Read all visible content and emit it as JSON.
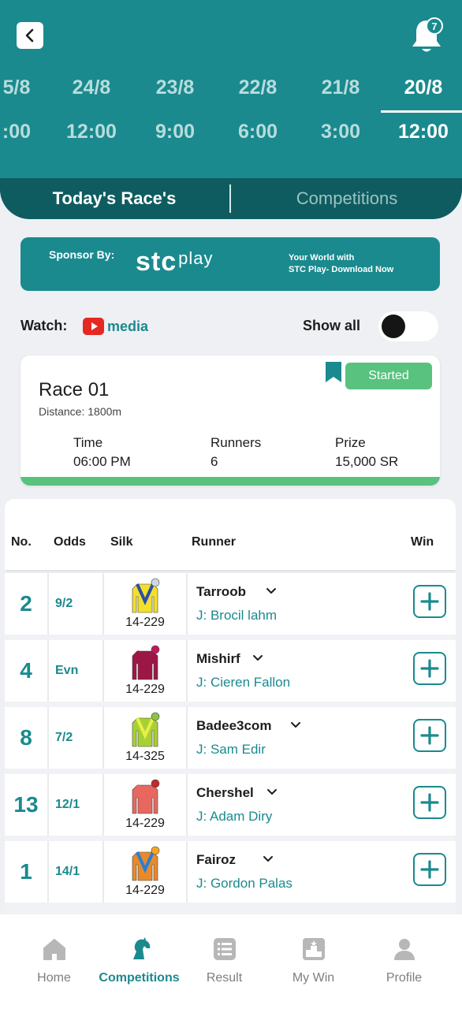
{
  "header": {
    "notification_count": "7",
    "dates": [
      {
        "date": "5/8",
        "time": ":00"
      },
      {
        "date": "24/8",
        "time": "12:00"
      },
      {
        "date": "23/8",
        "time": "9:00"
      },
      {
        "date": "22/8",
        "time": "6:00"
      },
      {
        "date": "21/8",
        "time": "3:00"
      },
      {
        "date": "20/8",
        "time": "12:00",
        "active": true
      }
    ],
    "tabs": [
      {
        "label": "Today's Race's",
        "active": true
      },
      {
        "label": "Competitions",
        "active": false
      }
    ]
  },
  "sponsor": {
    "label": "Sponsor By:",
    "brand": "stc",
    "brand_suffix": "play",
    "tagline_1": "Your World with",
    "tagline_2": "STC Play- Download Now"
  },
  "watch": {
    "label": "Watch:",
    "media_label": "media",
    "show_all_label": "Show all",
    "show_all_on": false
  },
  "race": {
    "title": "Race 01",
    "distance": "Distance: 1800m",
    "status": "Started",
    "time_label": "Time",
    "time_value": "06:00 PM",
    "runners_label": "Runners",
    "runners_value": "6",
    "prize_label": "Prize",
    "prize_value": "15,000 SR"
  },
  "table": {
    "headers": {
      "no": "No.",
      "odds": "Odds",
      "silk": "Silk",
      "runner": "Runner",
      "win": "Win"
    },
    "rows": [
      {
        "no": "2",
        "odds": "9/2",
        "silk_code": "14-229",
        "name": "Tarroob",
        "jockey": "J: Brocil lahm",
        "silk_color": "#f2e02b",
        "silk_accent": "#2d4fa8",
        "cap": "#cfd8e0"
      },
      {
        "no": "4",
        "odds": "Evn",
        "silk_code": "14-229",
        "name": "Mishirf",
        "jockey": "J: Cieren Fallon",
        "silk_color": "#9c1646",
        "silk_accent": "#9c1646",
        "cap": "#c2185b"
      },
      {
        "no": "8",
        "odds": "7/2",
        "silk_code": "14-325",
        "name": "Badee3com",
        "jockey": "J: Sam Edir",
        "silk_color": "#a7d133",
        "silk_accent": "#e8ef4a",
        "cap": "#8bc34a"
      },
      {
        "no": "13",
        "odds": "12/1",
        "silk_code": "14-229",
        "name": "Chershel",
        "jockey": "J: Adam Diry",
        "silk_color": "#e8675f",
        "silk_accent": "#e8675f",
        "cap": "#c62828"
      },
      {
        "no": "1",
        "odds": "14/1",
        "silk_code": "14-229",
        "name": "Fairoz",
        "jockey": "J: Gordon Palas",
        "silk_color": "#e88a2a",
        "silk_accent": "#2a7fd4",
        "cap": "#f5a623"
      }
    ]
  },
  "nav": [
    {
      "label": "Home",
      "icon": "home-icon"
    },
    {
      "label": "Competitions",
      "icon": "horse-icon",
      "active": true
    },
    {
      "label": "Result",
      "icon": "list-icon"
    },
    {
      "label": "My Win",
      "icon": "podium-icon"
    },
    {
      "label": "Profile",
      "icon": "profile-icon"
    }
  ],
  "colors": {
    "primary": "#1a8a8e",
    "dark": "#0f5c60",
    "success": "#58c27e"
  }
}
